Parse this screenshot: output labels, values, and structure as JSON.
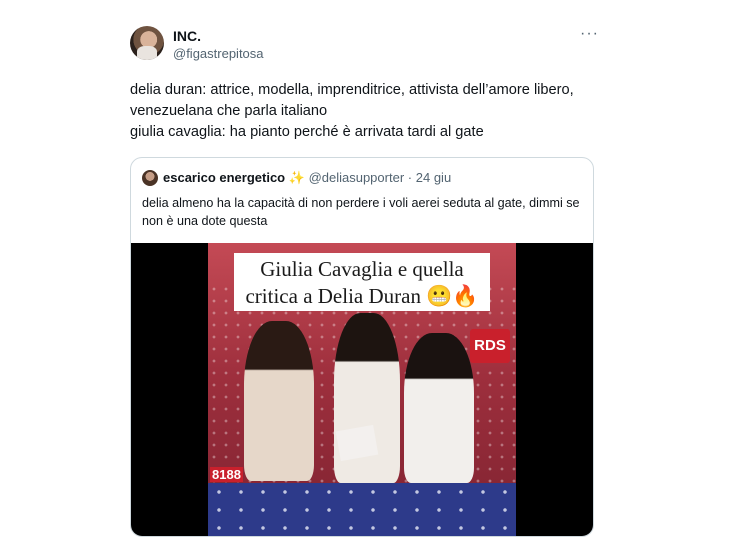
{
  "author": {
    "name": "INC.",
    "handle": "@figastrepitosa"
  },
  "more_label": "···",
  "tweet_lines": [
    "delia duran: attrice, modella, imprenditrice, attivista dell’amore libero,",
    "venezuelana che parla italiano",
    "giulia cavaglia: ha pianto perché è arrivata tardi al gate"
  ],
  "quote": {
    "name": "escarico energetico",
    "badge": "✨",
    "handle": "@deliasupporter",
    "separator": "·",
    "time": "24 giu",
    "text_lines": [
      "delia almeno ha la capacità di non perdere i voli aerei seduta al gate, dimmi se",
      "non è una dote questa"
    ],
    "media": {
      "caption_line1": "Giulia Cavaglia e quella",
      "caption_line2": "critica a Delia Duran 😬🔥",
      "logo_text": "RDS",
      "banner_number": "8188"
    }
  },
  "colors": {
    "text": "#0f1419",
    "secondary": "#536471",
    "border": "#cfd9de"
  }
}
